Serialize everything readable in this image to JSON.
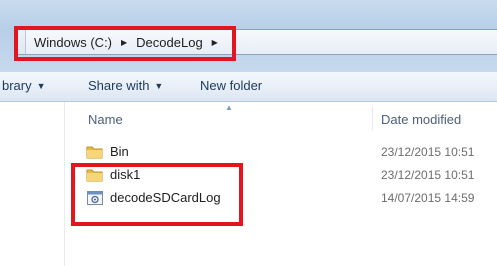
{
  "address_bar": {
    "crumbs": [
      "Windows (C:)",
      "DecodeLog"
    ]
  },
  "toolbar": {
    "library_label": "brary",
    "share_label": "Share with",
    "new_folder_label": "New folder"
  },
  "columns": {
    "name": "Name",
    "date_modified": "Date modified"
  },
  "files": [
    {
      "name": "Bin",
      "date": "23/12/2015 10:51",
      "icon": "folder-icon"
    },
    {
      "name": "disk1",
      "date": "23/12/2015 10:51",
      "icon": "folder-icon"
    },
    {
      "name": "decodeSDCardLog",
      "date": "14/07/2015 14:59",
      "icon": "application-icon"
    }
  ],
  "colors": {
    "highlight": "#e3161f",
    "toolbar_text": "#1e395b",
    "header_text": "#4c607a",
    "date_text": "#6d6d6d"
  }
}
